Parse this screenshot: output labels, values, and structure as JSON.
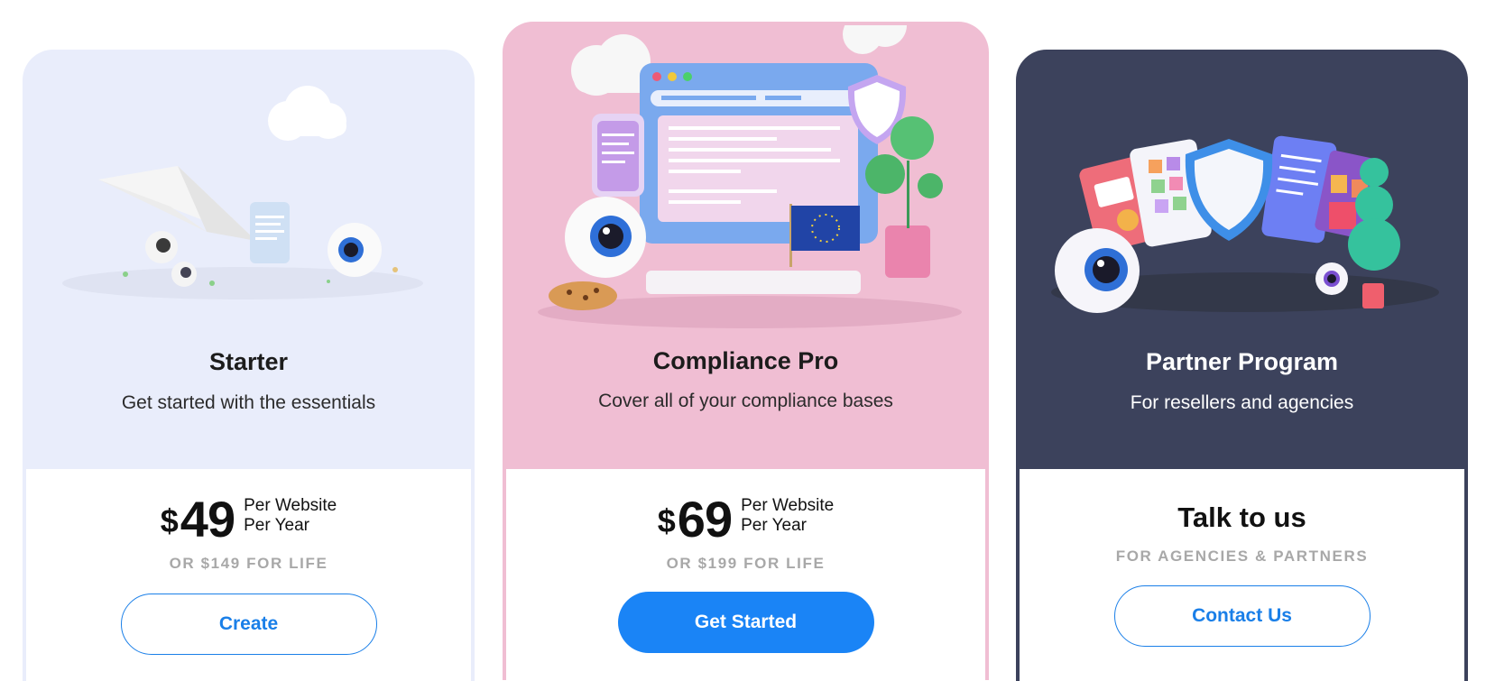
{
  "plans": {
    "starter": {
      "title": "Starter",
      "subtitle": "Get started with the essentials",
      "currency": "$",
      "price": "49",
      "per_line1": "Per Website",
      "per_line2": "Per Year",
      "lifetime": "OR $149 FOR LIFE",
      "cta": "Create",
      "bg_color": "#e9edfb"
    },
    "pro": {
      "title": "Compliance Pro",
      "subtitle": "Cover all of your compliance bases",
      "currency": "$",
      "price": "69",
      "per_line1": "Per Website",
      "per_line2": "Per Year",
      "lifetime": "OR $199 FOR LIFE",
      "cta": "Get Started",
      "bg_color": "#f0bed3"
    },
    "partner": {
      "title": "Partner Program",
      "subtitle": "For resellers and agencies",
      "heading": "Talk to us",
      "tagline": "FOR AGENCIES & PARTNERS",
      "cta": "Contact Us",
      "bg_color": "#3c425c"
    }
  },
  "colors": {
    "accent": "#1a84f6",
    "muted_text": "#a8a8a8"
  },
  "icons": {
    "starter_illustration": "paper-plane-eyes-illustration",
    "pro_illustration": "browser-shield-eu-flag-illustration",
    "partner_illustration": "documents-shield-eyes-illustration"
  }
}
